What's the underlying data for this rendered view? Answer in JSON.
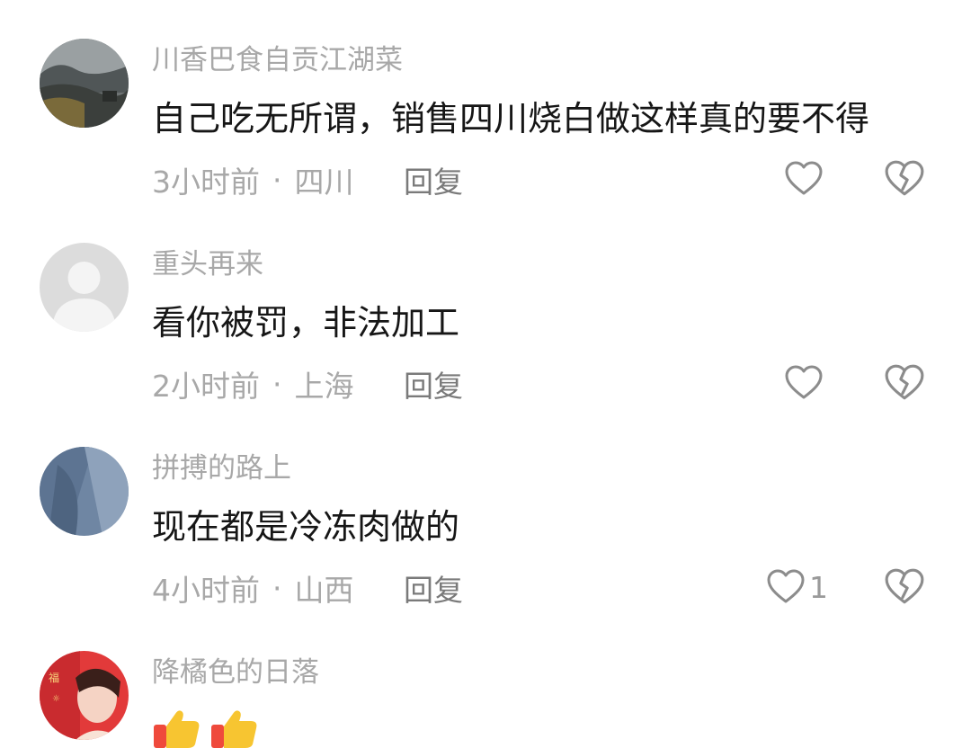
{
  "comments": [
    {
      "username": "川香巴食自贡江湖菜",
      "content": "自己吃无所谓，销售四川烧白做这样真的要不得",
      "time": "3小时前",
      "separator": "·",
      "location": "四川",
      "reply_label": "回复",
      "like_count": "",
      "avatar_icon": "landscape-avatar"
    },
    {
      "username": "重头再来",
      "content": "看你被罚，非法加工",
      "time": "2小时前",
      "separator": "·",
      "location": "上海",
      "reply_label": "回复",
      "like_count": "",
      "avatar_icon": "default-person-avatar"
    },
    {
      "username": "拼搏的路上",
      "content": "现在都是冷冻肉做的",
      "time": "4小时前",
      "separator": "·",
      "location": "山西",
      "reply_label": "回复",
      "like_count": "1",
      "avatar_icon": "blue-photo-avatar"
    },
    {
      "username": "降橘色的日落",
      "content_emoji": [
        "thumbs-up-emoji",
        "thumbs-up-emoji"
      ],
      "avatar_icon": "red-portrait-avatar"
    }
  ],
  "icons": {
    "like": "heart-outline-icon",
    "dislike": "broken-heart-icon"
  },
  "colors": {
    "username": "#a8a8a8",
    "content": "#161616",
    "meta": "#a8a8a8",
    "icon_stroke": "#8c8c8c",
    "emoji_yellow": "#f7c531",
    "emoji_sleeve": "#ef4a3c"
  }
}
